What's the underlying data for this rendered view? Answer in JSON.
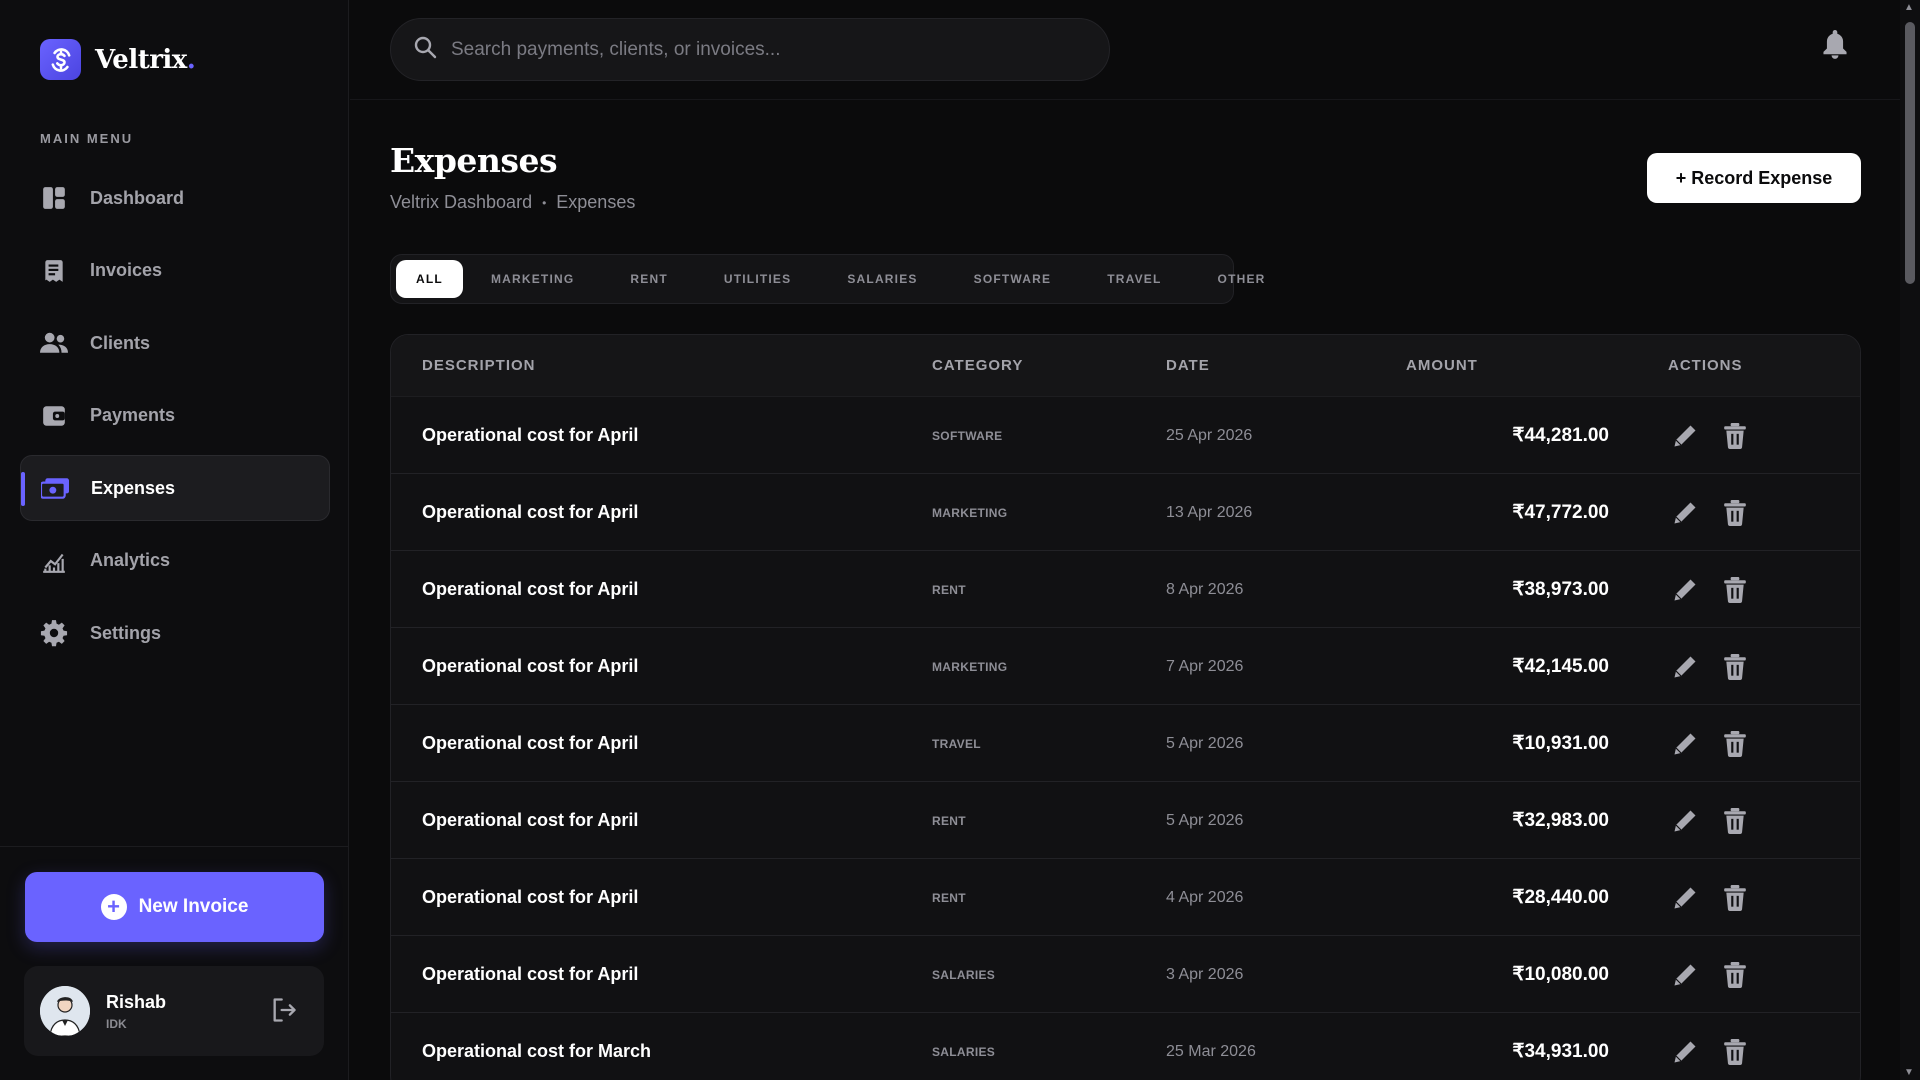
{
  "brand": {
    "name": "Veltrix",
    "dot": "."
  },
  "sidebar": {
    "menu_title": "MAIN MENU",
    "items": [
      {
        "label": "Dashboard",
        "icon": "dashboard-icon"
      },
      {
        "label": "Invoices",
        "icon": "invoice-icon"
      },
      {
        "label": "Clients",
        "icon": "users-icon"
      },
      {
        "label": "Payments",
        "icon": "wallet-icon"
      },
      {
        "label": "Expenses",
        "icon": "cash-icon",
        "active": true
      },
      {
        "label": "Analytics",
        "icon": "chart-icon"
      },
      {
        "label": "Settings",
        "icon": "gear-icon"
      }
    ],
    "new_invoice_label": "New Invoice",
    "user": {
      "name": "Rishab",
      "role": "IDK"
    }
  },
  "search": {
    "placeholder": "Search payments, clients, or invoices..."
  },
  "page": {
    "title": "Expenses",
    "breadcrumb": [
      "Veltrix Dashboard",
      "Expenses"
    ],
    "breadcrumb_sep": "•",
    "record_button": "+ Record Expense"
  },
  "filters": [
    "ALL",
    "MARKETING",
    "RENT",
    "UTILITIES",
    "SALARIES",
    "SOFTWARE",
    "TRAVEL",
    "OTHER"
  ],
  "active_filter": "ALL",
  "table": {
    "headers": {
      "description": "DESCRIPTION",
      "category": "CATEGORY",
      "date": "DATE",
      "amount": "AMOUNT",
      "actions": "ACTIONS"
    },
    "rows": [
      {
        "description": "Operational cost for April",
        "category": "SOFTWARE",
        "date": "25 Apr 2026",
        "amount": "₹44,281.00"
      },
      {
        "description": "Operational cost for April",
        "category": "MARKETING",
        "date": "13 Apr 2026",
        "amount": "₹47,772.00"
      },
      {
        "description": "Operational cost for April",
        "category": "RENT",
        "date": "8 Apr 2026",
        "amount": "₹38,973.00"
      },
      {
        "description": "Operational cost for April",
        "category": "MARKETING",
        "date": "7 Apr 2026",
        "amount": "₹42,145.00"
      },
      {
        "description": "Operational cost for April",
        "category": "TRAVEL",
        "date": "5 Apr 2026",
        "amount": "₹10,931.00"
      },
      {
        "description": "Operational cost for April",
        "category": "RENT",
        "date": "5 Apr 2026",
        "amount": "₹32,983.00"
      },
      {
        "description": "Operational cost for April",
        "category": "RENT",
        "date": "4 Apr 2026",
        "amount": "₹28,440.00"
      },
      {
        "description": "Operational cost for April",
        "category": "SALARIES",
        "date": "3 Apr 2026",
        "amount": "₹10,080.00"
      },
      {
        "description": "Operational cost for March",
        "category": "SALARIES",
        "date": "25 Mar 2026",
        "amount": "₹34,931.00"
      }
    ]
  },
  "colors": {
    "accent": "#6a63ff",
    "background": "#0b0b0c",
    "surface": "#111113"
  }
}
